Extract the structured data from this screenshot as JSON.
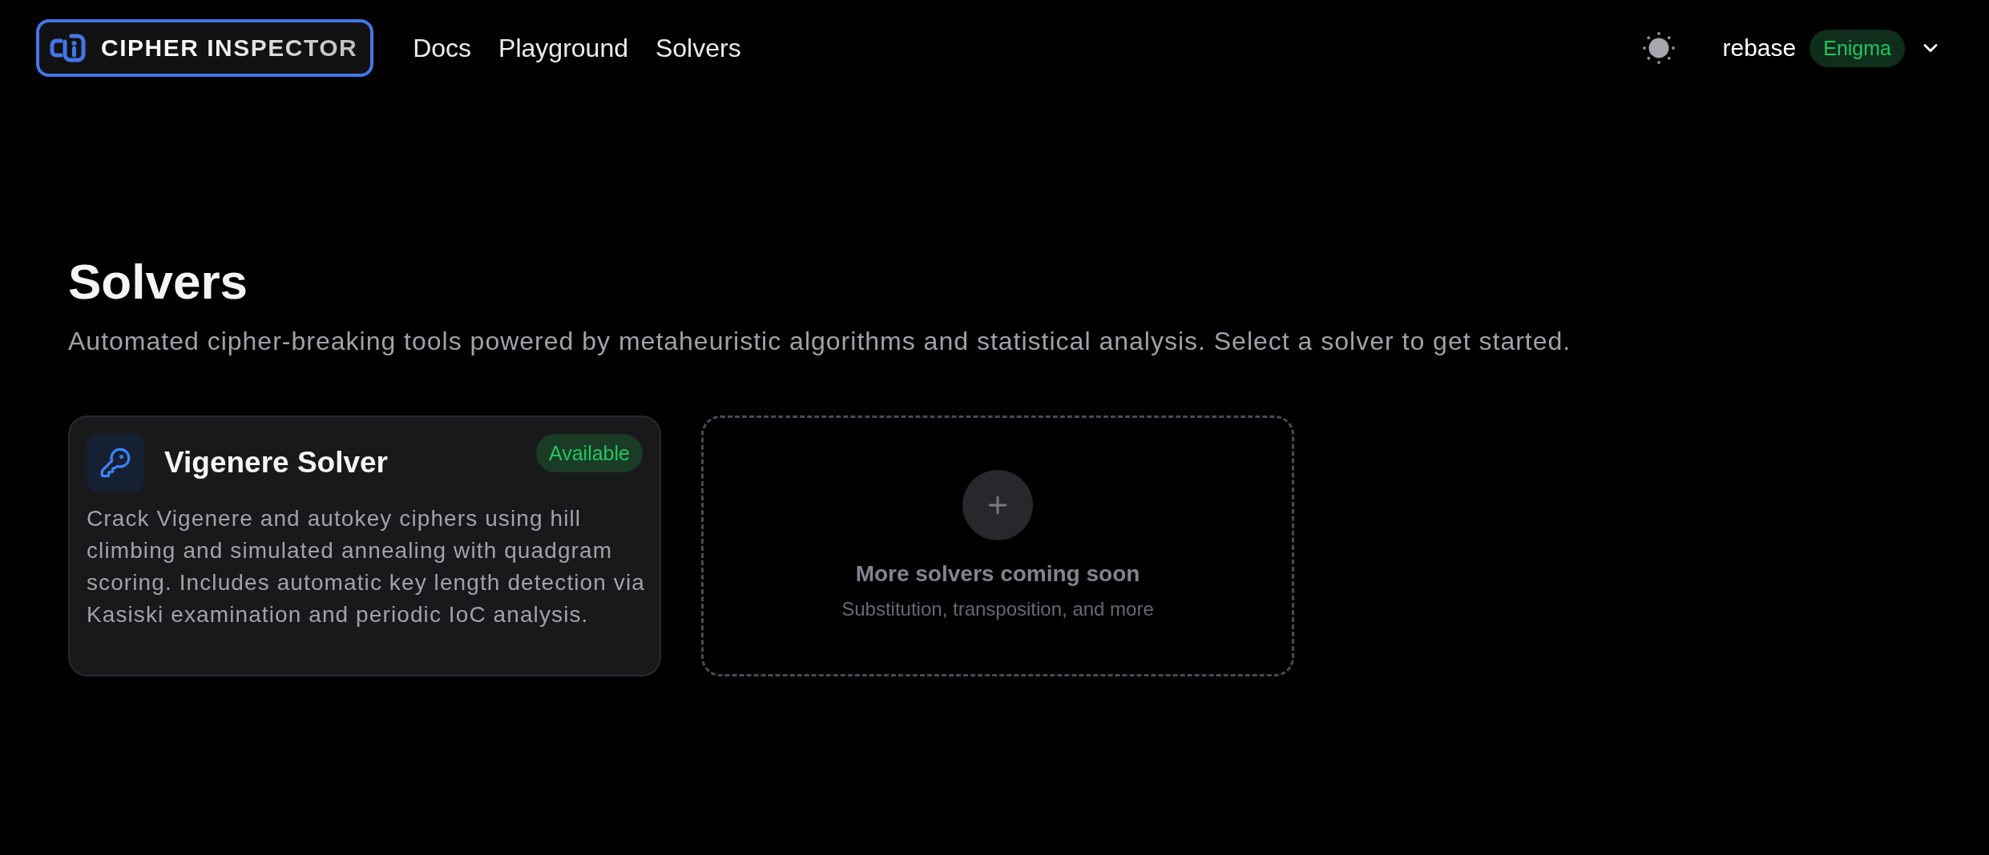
{
  "header": {
    "logo": {
      "text": "CIPHER INSPECTOR"
    },
    "nav": [
      {
        "label": "Docs"
      },
      {
        "label": "Playground"
      },
      {
        "label": "Solvers"
      }
    ],
    "user": {
      "name": "rebase",
      "badge": "Enigma"
    }
  },
  "page": {
    "title": "Solvers",
    "subtitle": "Automated cipher-breaking tools powered by metaheuristic algorithms and statistical analysis. Select a solver to get started."
  },
  "solvers": [
    {
      "kind": "solver",
      "title": "Vigenere Solver",
      "badge": "Available",
      "description": "Crack Vigenere and autokey ciphers using hill climbing and simulated annealing with quadgram scoring. Includes automatic key length detection via Kasiski examination and periodic IoC analysis."
    },
    {
      "kind": "placeholder",
      "title": "More solvers coming soon",
      "subtitle": "Substitution, transposition, and more"
    }
  ]
}
